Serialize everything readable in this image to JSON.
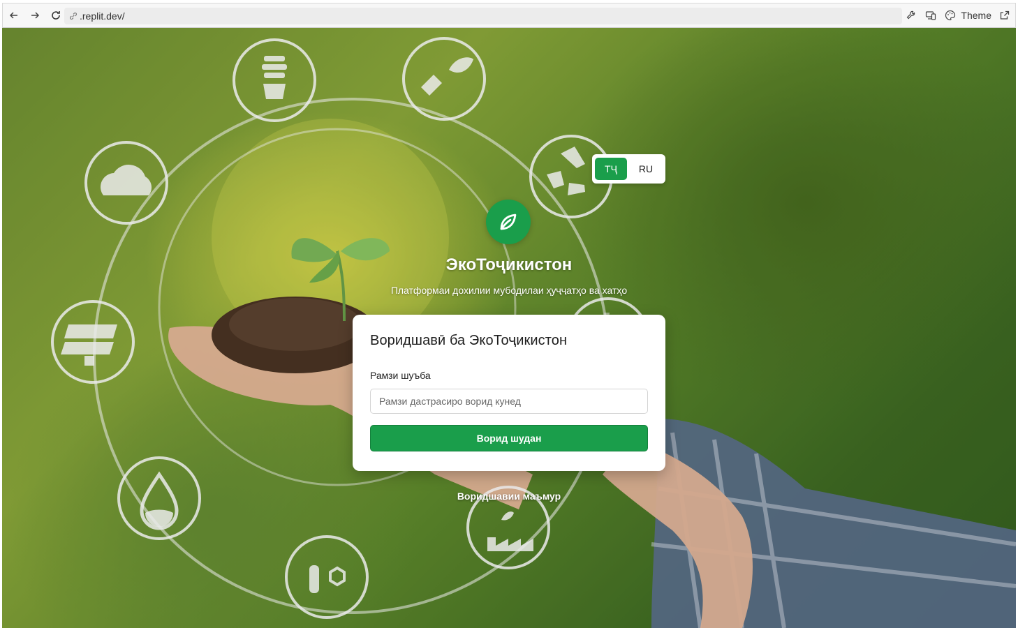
{
  "browser": {
    "url": ".replit.dev/",
    "theme_label": "Theme",
    "icons": [
      "back-arrow-icon",
      "forward-arrow-icon",
      "reload-icon",
      "link-icon",
      "wrench-icon",
      "devices-icon",
      "palette-icon",
      "external-link-icon"
    ]
  },
  "language": {
    "options": [
      {
        "label": "ТҶ",
        "active": true
      },
      {
        "label": "RU",
        "active": false
      }
    ]
  },
  "brand": {
    "icon": "leaf-icon",
    "title": "ЭкоТоҷикистон",
    "subtitle": "Платформаи дохилии мубодилаи ҳуҷҷатҳо ва хатҳо"
  },
  "login": {
    "title": "Воридшавӣ ба ЭкоТоҷикистон",
    "field_label": "Рамзи шуъба",
    "field_placeholder": "Рамзи дастрасиро ворид кунед",
    "field_value": "",
    "submit_label": "Ворид шудан"
  },
  "admin_link": "Воридшавии маъмур",
  "colors": {
    "accent": "#1a9e4b",
    "card_bg": "#ffffff",
    "background": "#5f8a2c"
  },
  "background_icons": [
    "lightbulb-icon",
    "plug-leaf-icon",
    "recycle-icon",
    "co2-cloud-icon",
    "solar-panel-icon",
    "wind-turbine-icon",
    "water-drop-icon",
    "flask-molecule-icon",
    "factory-icon"
  ]
}
